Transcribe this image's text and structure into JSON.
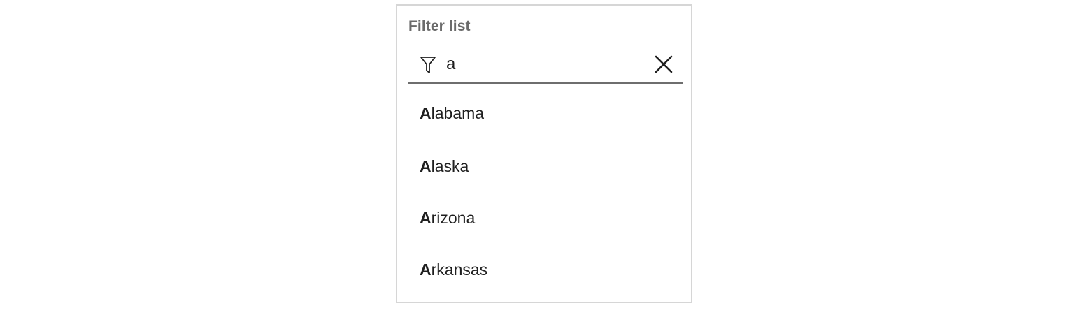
{
  "filter": {
    "label": "Filter list",
    "value": "a",
    "icon": "filter-icon",
    "clear_icon": "close-icon"
  },
  "results": [
    {
      "match": "A",
      "rest": "labama"
    },
    {
      "match": "A",
      "rest": "laska"
    },
    {
      "match": "A",
      "rest": "rizona"
    },
    {
      "match": "A",
      "rest": "rkansas"
    }
  ]
}
